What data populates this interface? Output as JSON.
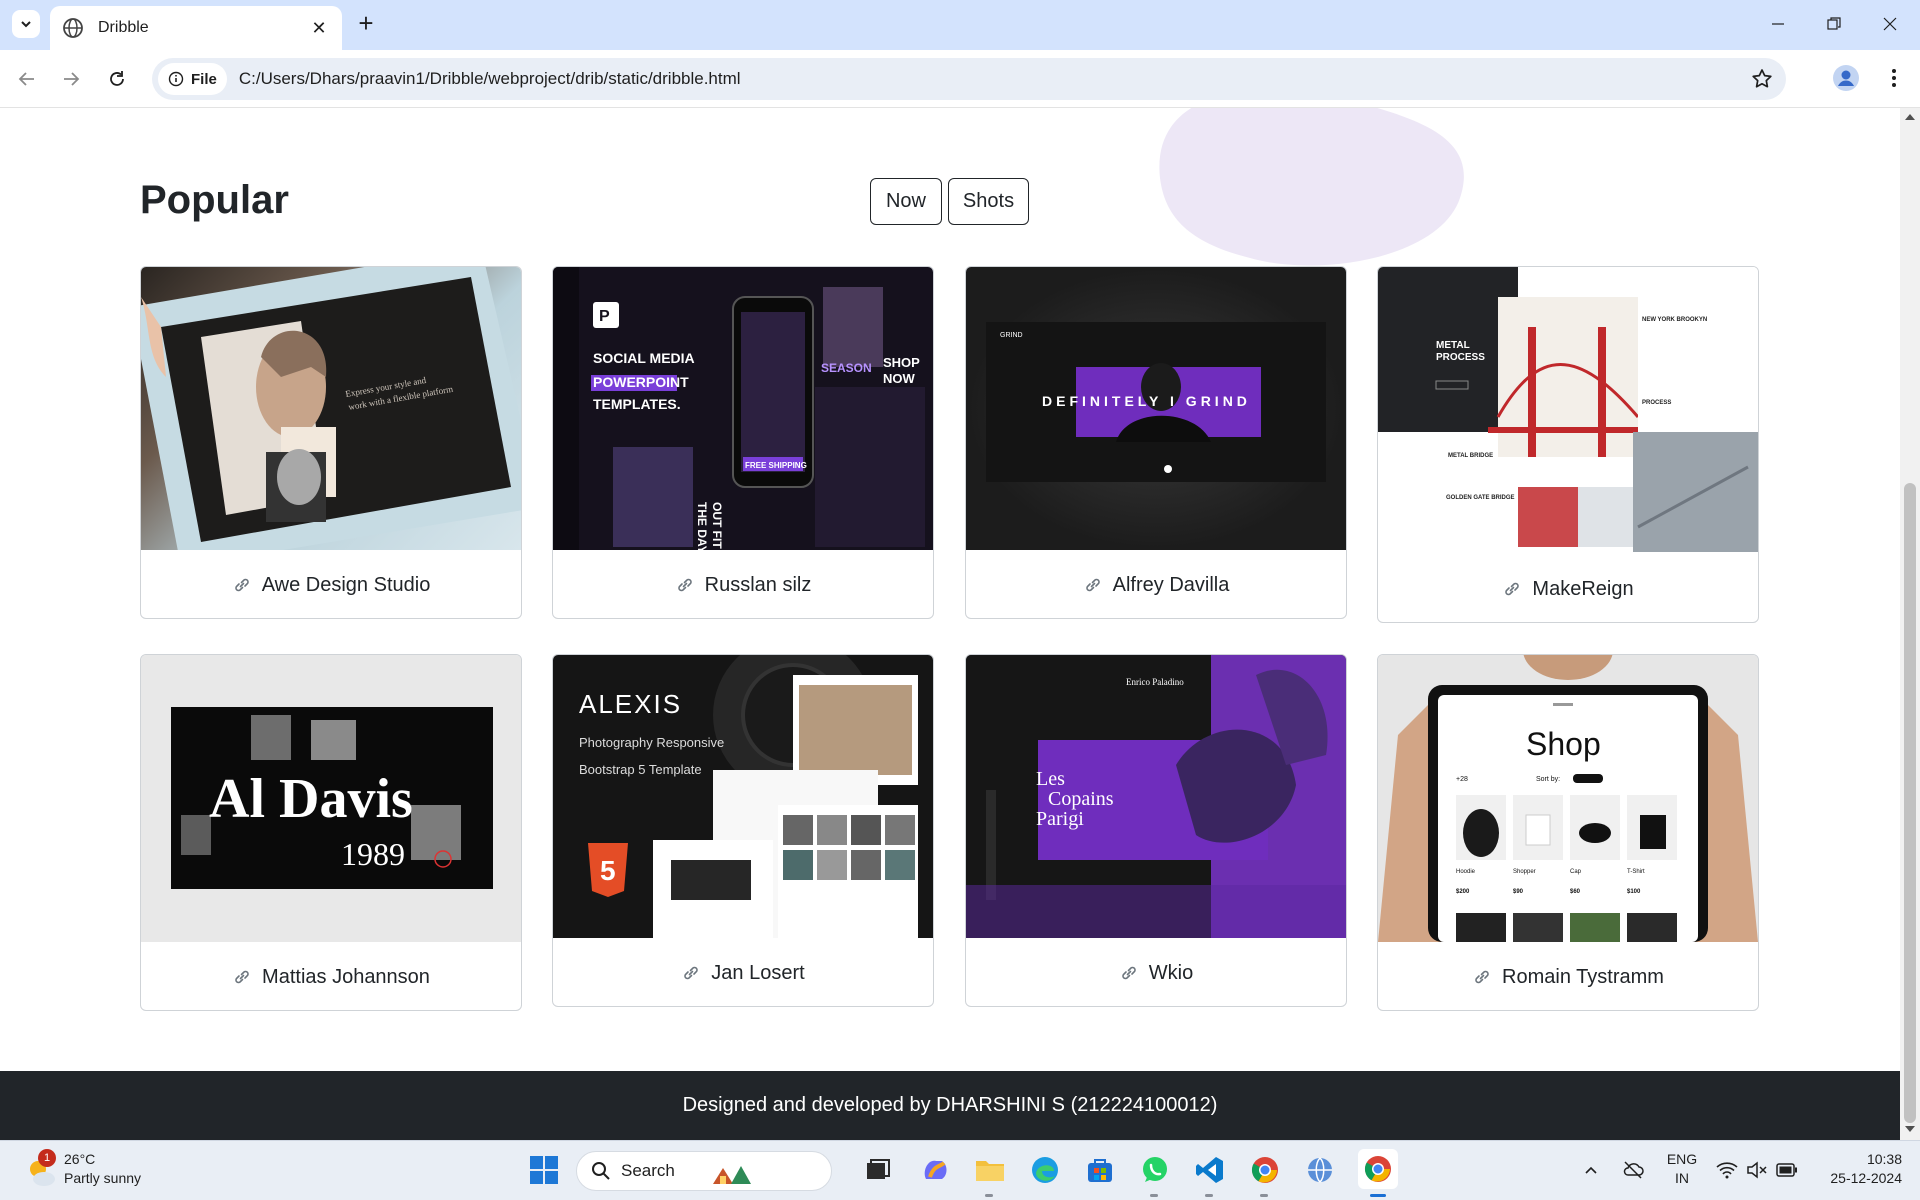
{
  "browser": {
    "tab_title": "Dribble",
    "url_chip": "File",
    "url": "C:/Users/Dhars/praavin1/Dribble/webproject/drib/static/dribble.html"
  },
  "page": {
    "heading": "Popular",
    "filters": [
      "Now",
      "Shots"
    ],
    "cards": [
      {
        "name": "Awe Design Studio",
        "thumb": "tablet-portrait"
      },
      {
        "name": "Russlan silz",
        "thumb": "social-media-templates"
      },
      {
        "name": "Alfrey Davilla",
        "thumb": "definitely-i-grind"
      },
      {
        "name": "MakeReign",
        "thumb": "metal-process"
      },
      {
        "name": "Mattias Johannson",
        "thumb": "al-davis"
      },
      {
        "name": "Jan Losert",
        "thumb": "alexis"
      },
      {
        "name": "Wkio",
        "thumb": "les-copains"
      },
      {
        "name": "Romain Tystramm",
        "thumb": "shop"
      }
    ],
    "thumb_text": {
      "social": [
        "SOCIAL MEDIA",
        "POWERPOINT",
        "TEMPLATES."
      ],
      "social_side": [
        "SEASON",
        "SHOP",
        "NOW",
        "FREE SHIPPING",
        "OUT FIT OF",
        "THE DAY"
      ],
      "grind": "DEFINITELY I GRIND",
      "metal": [
        "METAL",
        "PROCESS"
      ],
      "metal_side": [
        "NEW YORK BROOKYN",
        "PROCESS",
        "METAL BRIDGE",
        "GOLDEN GATE BRIDGE"
      ],
      "aldavis": [
        "Al Davis",
        "1989"
      ],
      "alexis": [
        "ALEXIS",
        "Photography Responsive",
        "Bootstrap 5 Template"
      ],
      "copains": [
        "Les",
        "Copains",
        "Parigi",
        "Enrico Paladino"
      ],
      "shop": [
        "Shop",
        "+28",
        "Sort by:",
        "Hoodie",
        "Shopper",
        "Cap",
        "T-Shirt",
        "$200",
        "$90",
        "$60",
        "$100"
      ]
    },
    "footer": "Designed and developed by DHARSHINI S (212224100012)"
  },
  "taskbar": {
    "weather_temp": "26°C",
    "weather_cond": "Partly sunny",
    "weather_badge": "1",
    "search": "Search",
    "lang1": "ENG",
    "lang2": "IN",
    "time": "10:38",
    "date": "25-12-2024"
  },
  "colors": {
    "tab_bar": "#d3e3fd",
    "footer": "#212529",
    "accent_purple": "#6f2dbd"
  }
}
